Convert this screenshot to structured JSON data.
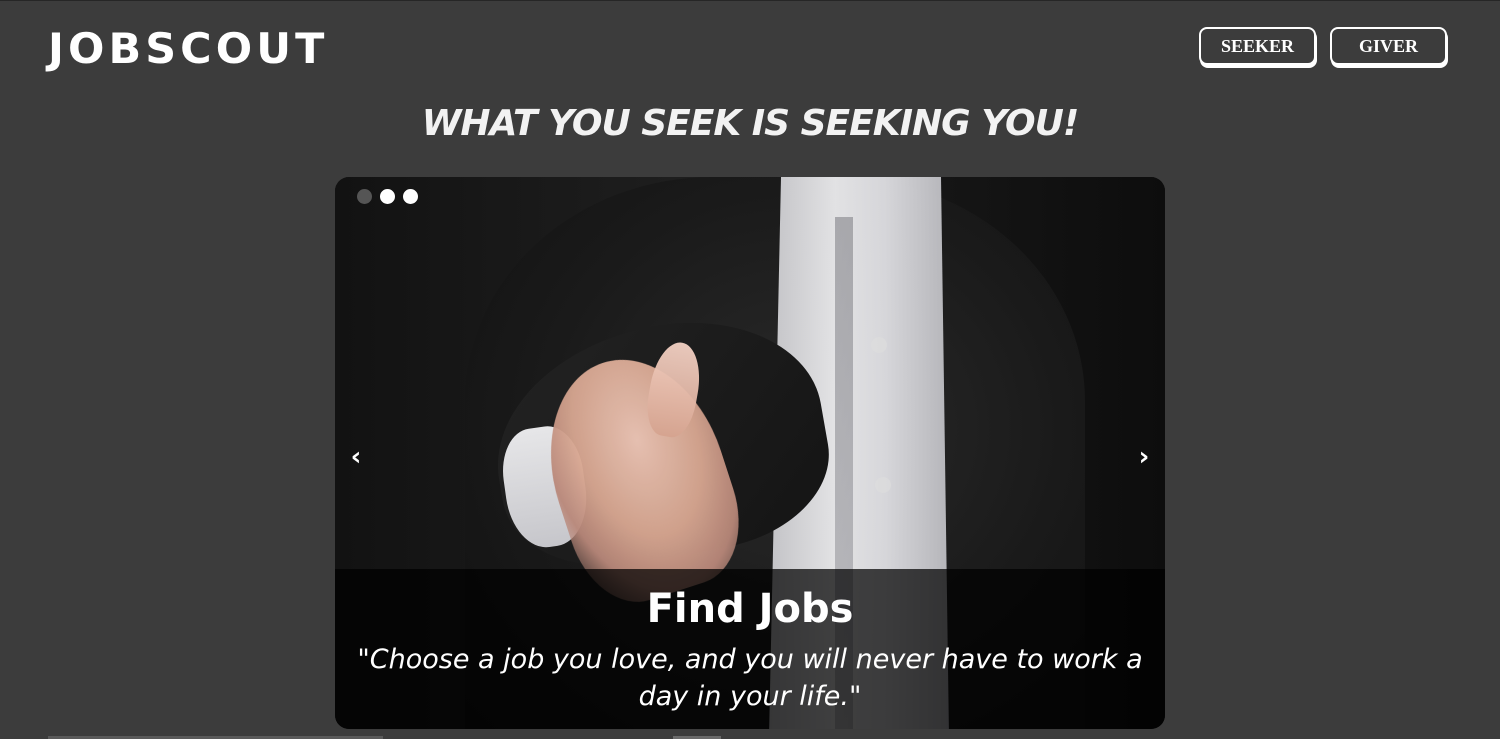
{
  "header": {
    "logo": "JOBSCOUT",
    "nav": [
      {
        "label": "SEEKER"
      },
      {
        "label": "GIVER"
      }
    ]
  },
  "tagline": "WHAT YOU SEEK IS SEEKING YOU!",
  "carousel": {
    "indicators": [
      {
        "active": false
      },
      {
        "active": true
      },
      {
        "active": true
      }
    ],
    "prev_label": "‹",
    "next_label": "›",
    "slide": {
      "title": "Find Jobs",
      "quote": "\"Choose a job you love, and you will never have to work a day in your life.\""
    }
  },
  "colors": {
    "background": "#3c3c3c",
    "text": "#ffffff",
    "caption_overlay": "#000000"
  }
}
